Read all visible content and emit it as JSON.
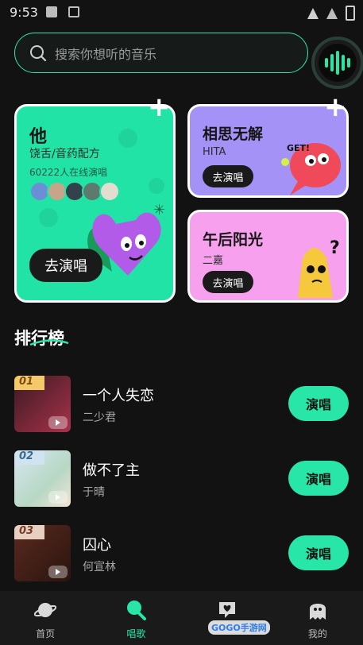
{
  "status_bar": {
    "time": "9:53"
  },
  "search": {
    "placeholder": "搜索你想听的音乐"
  },
  "featured": {
    "main": {
      "title": "他",
      "subtitle": "饶舌/音药配方",
      "online": "60222人在线演唱",
      "button": "去演唱"
    },
    "side": [
      {
        "title": "相思无解",
        "artist": "HITA",
        "button": "去演唱"
      },
      {
        "title": "午后阳光",
        "artist": "二嘉",
        "button": "去演唱"
      }
    ]
  },
  "ranking": {
    "title": "排行榜",
    "items": [
      {
        "rank": "01",
        "song": "一个人失恋",
        "artist": "二少君",
        "button": "演唱"
      },
      {
        "rank": "02",
        "song": "做不了主",
        "artist": "于晴",
        "button": "演唱"
      },
      {
        "rank": "03",
        "song": "囚心",
        "artist": "何宣林",
        "button": "演唱"
      }
    ]
  },
  "tabs": [
    {
      "label": "首页",
      "icon": "planet-icon"
    },
    {
      "label": "唱歌",
      "icon": "microphone-icon",
      "active": true
    },
    {
      "label": "",
      "icon": "heart-message-icon"
    },
    {
      "label": "我的",
      "icon": "ghost-icon"
    }
  ],
  "watermark": "GOGO手游网",
  "colors": {
    "accent": "#27e6a8",
    "featured_main": "#22e3a6",
    "featured_side_1": "#a592f7",
    "featured_side_2": "#f6a0ee"
  }
}
